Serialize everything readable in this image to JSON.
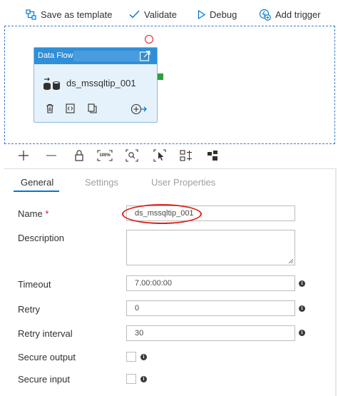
{
  "toolbar": {
    "save_template": "Save as template",
    "validate": "Validate",
    "debug": "Debug",
    "add_trigger": "Add trigger"
  },
  "activity": {
    "title": "Data Flow",
    "name": "ds_mssqltip_001"
  },
  "zoom_toolbar": {
    "zoom_percent_label": "100%"
  },
  "tabs": [
    {
      "label": "General",
      "active": true
    },
    {
      "label": "Settings",
      "active": false
    },
    {
      "label": "User Properties",
      "active": false
    }
  ],
  "form": {
    "name_label": "Name",
    "name_required_mark": "*",
    "name_value": "ds_mssqltip_001",
    "description_label": "Description",
    "description_value": "",
    "timeout_label": "Timeout",
    "timeout_value": "7.00:00:00",
    "retry_label": "Retry",
    "retry_value": "0",
    "retry_interval_label": "Retry interval",
    "retry_interval_value": "30",
    "secure_output_label": "Secure output",
    "secure_output_checked": false,
    "secure_input_label": "Secure input",
    "secure_input_checked": false,
    "info_glyph": "i"
  },
  "colors": {
    "accent": "#0078d4",
    "activity_header": "#2f8fd8",
    "activity_body": "#e6f2fb",
    "annotation_red": "#d9231c",
    "output_port": "#2e9e3e"
  }
}
